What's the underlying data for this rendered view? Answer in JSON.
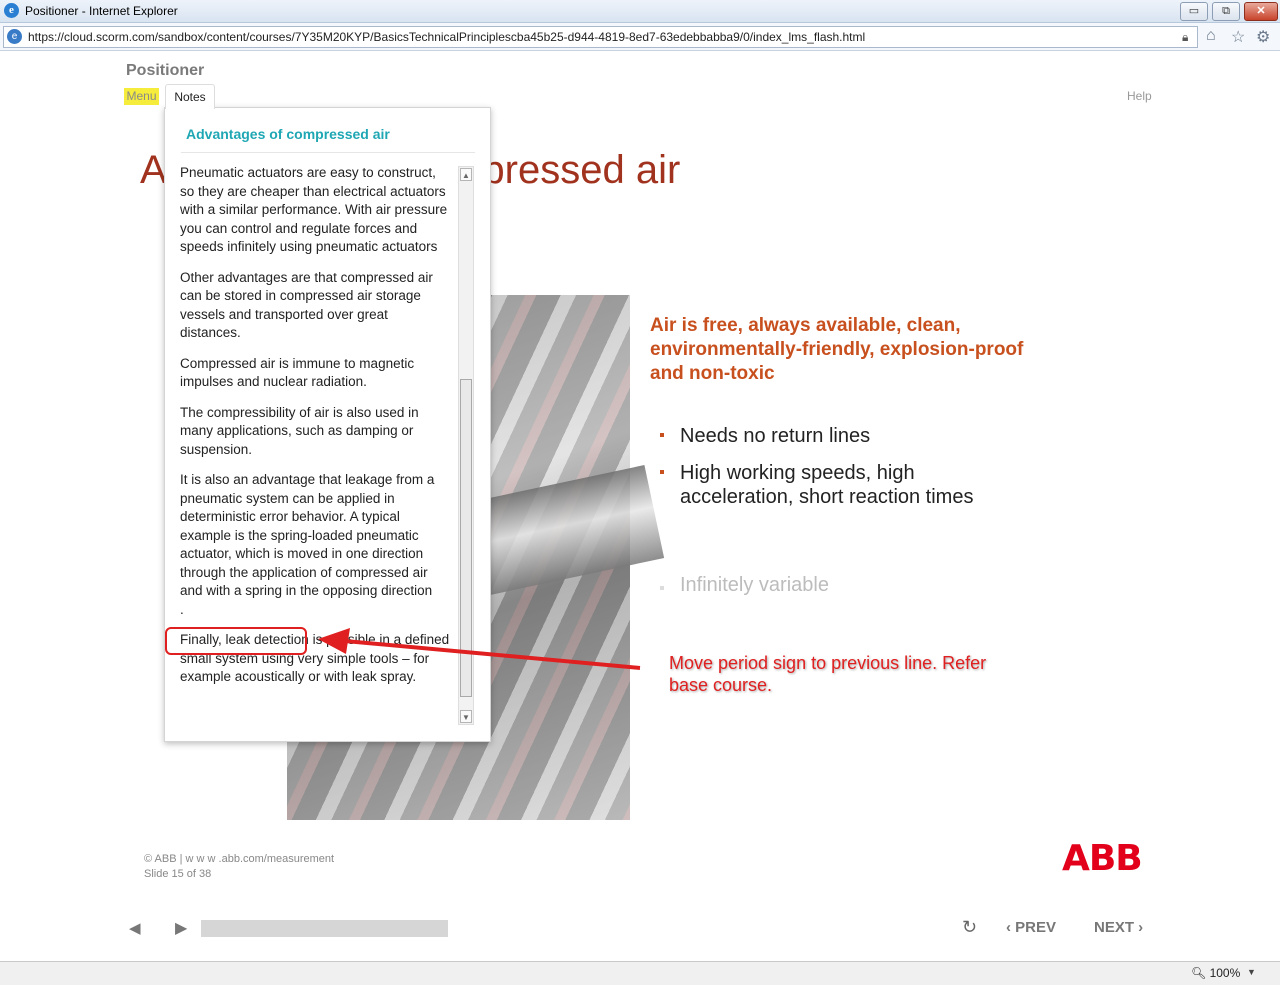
{
  "window": {
    "title": "Positioner - Internet Explorer",
    "minimize": "▭",
    "restore": "⧉",
    "close": "✕"
  },
  "address": {
    "url": "https://cloud.scorm.com/sandbox/content/courses/7Y35M20KYP/BasicsTechnicalPrinciplescba45b25-d944-4819-8ed7-63edebbabba9/0/index_lms_flash.html"
  },
  "course": {
    "title": "Positioner",
    "menu_label": "Menu",
    "notes_label": "Notes",
    "help_label": "Help"
  },
  "slide": {
    "heading": "Advantages of compressed air",
    "subheading": "Air is free, always available, clean, environmentally-friendly, explosion-proof and non-toxic",
    "bullets": [
      "Needs no return lines",
      "High working speeds, high acceleration, short reaction times"
    ],
    "faded_bullet": "Infinitely variable",
    "copyright": "© ABB | w w w .abb.com/measurement",
    "slide_counter": "Slide 15 of 38",
    "logo": "ABB"
  },
  "notes": {
    "title": "Advantages of compressed air",
    "paragraphs": [
      "Pneumatic actuators are easy to construct, so they are cheaper than electrical actuators with a similar performance. With air pressure you can control and regulate forces and speeds infinitely using pneumatic actuators",
      "Other advantages are that compressed air can be stored in compressed air storage vessels and transported over great distances.",
      "Compressed air is immune to magnetic impulses and nuclear radiation.",
      "The compressibility of air is also used in many applications, such as damping or suspension.",
      "It is also an advantage that leakage from a pneumatic system can be applied in deterministic error behavior. A typical example is the spring-loaded pneumatic actuator, which is moved in one direction through the application of compressed air and with a spring in the opposing direction",
      ".",
      "Finally, leak detection is possible in a defined small system using very simple tools – for example acoustically or with leak spray."
    ]
  },
  "annotation": {
    "text": "Move period sign to previous line. Refer base course.",
    "color": "#e02020"
  },
  "controls": {
    "prev_label": "PREV",
    "next_label": "NEXT"
  },
  "status": {
    "zoom": "100%"
  },
  "icons": [
    "ie-icon",
    "lock-icon",
    "home-icon",
    "star-icon",
    "gear-icon",
    "volume-icon",
    "play-icon",
    "replay-icon",
    "chevron-left-icon",
    "chevron-right-icon",
    "zoom-icon"
  ],
  "colors": {
    "heading": "#a0321e",
    "subheading": "#c8501e",
    "notes_title": "#1fa7b4",
    "abb_red": "#e2001a",
    "menu_highlight": "#f5ec3b"
  }
}
